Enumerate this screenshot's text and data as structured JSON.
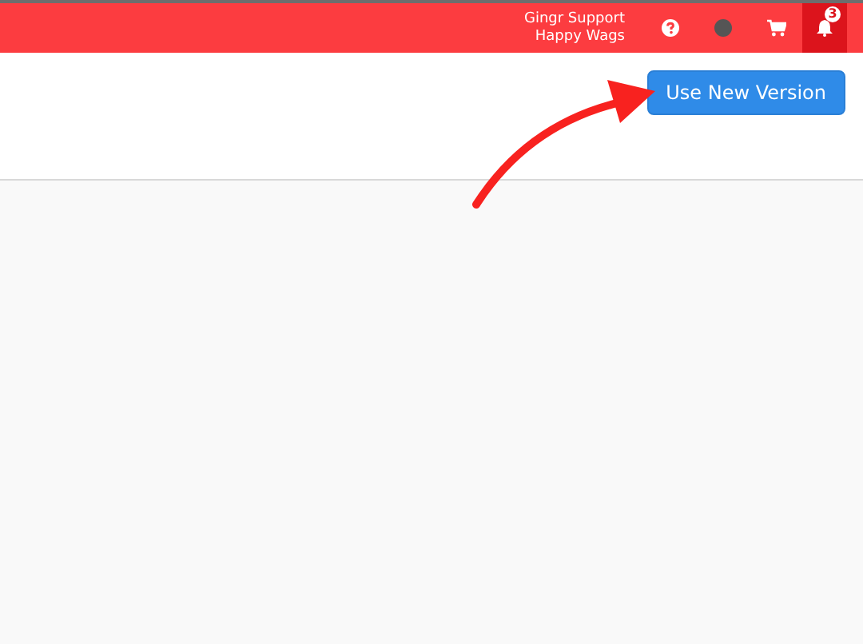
{
  "top_bar": {
    "user_name": "Gingr Support",
    "location": "Happy Wags",
    "notifications": {
      "count": "3",
      "selected": true
    }
  },
  "header": {
    "button": "Use New Version"
  }
}
